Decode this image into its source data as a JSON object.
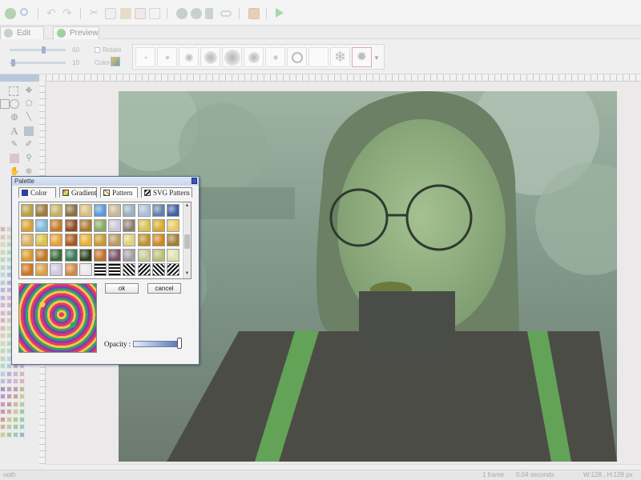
{
  "toolbar": {
    "icons": [
      "app-icon",
      "zoom-icon",
      "undo-icon",
      "redo-icon",
      "cut-icon",
      "copy-icon",
      "paste-icon",
      "delete-icon",
      "duplicate-icon",
      "filter-icon",
      "effects-icon",
      "stamp-icon",
      "link-icon",
      "image-icon",
      "play-icon"
    ]
  },
  "tabs": {
    "edit": "Edit",
    "preview": "Preview"
  },
  "options": {
    "size_value": "60",
    "space_value": "10",
    "rotate_label": "Rotate",
    "color_label": "Color"
  },
  "canvas": {
    "image": "portrait photo with green tint"
  },
  "status": {
    "left": "ooth",
    "frames": "1 frame",
    "duration": "0.04 seconds",
    "dimensions": "W:128 , H:128 px"
  },
  "palette": {
    "title": "Palette",
    "tabs": [
      "Color",
      "Gradient",
      "Pattern",
      "SVG Pattern"
    ],
    "active_tab": "Pattern",
    "ok_label": "ok",
    "cancel_label": "cancel",
    "opacity_label": "Opacity :",
    "opacity_value": 0.95,
    "pattern_colors": [
      "#b8a040",
      "#9a7a38",
      "#c8b060",
      "#8a7040",
      "#d8c080",
      "#5a9ad8",
      "#c8b898",
      "#9ab0c0",
      "#a8c0d8",
      "#6080a8",
      "#4060a0",
      "#d8a030",
      "#7ab8d8",
      "#c87828",
      "#904820",
      "#a87830",
      "#88a860",
      "#c8c8d8",
      "#8a8070",
      "#d8c050",
      "#d8a828",
      "#e8c860",
      "#d8b060",
      "#d8c040",
      "#e8a030",
      "#a85818",
      "#e8b030",
      "#c89830",
      "#b89860",
      "#e0d080",
      "#c09028",
      "#d08820",
      "#a08030",
      "#d89828",
      "#c07820",
      "#386838",
      "#3a7a58",
      "#2a4020",
      "#c07028",
      "#785068",
      "#a0a0a0",
      "#c8c898",
      "#b8c070",
      "#e0e0b0",
      "#d07018",
      "#d8a040",
      "#d0c8e0",
      "#d08840",
      "#e8e8e8",
      "#f0f0f0",
      "#c8c8c8",
      "#ffffff",
      "#f8f8f8",
      "#ffffff",
      "#ffffff"
    ]
  }
}
